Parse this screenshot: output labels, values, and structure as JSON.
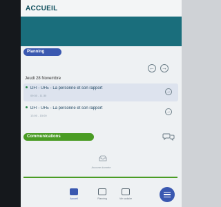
{
  "header": {
    "title": "ACCUEIL"
  },
  "hero": {
    "greeting": ""
  },
  "planning": {
    "label": "Planning",
    "date": "Jeudi 28 Novembre",
    "prev_icon": "arrow-left-icon",
    "next_icon": "arrow-right-icon",
    "courses": [
      {
        "title": "DFI - UFE - La personne et son rapport",
        "time": "09:30 - 11:30"
      },
      {
        "title": "DFI - UFE - La personne et son rapport",
        "time": "13:00 - 15:00"
      }
    ]
  },
  "communications": {
    "label": "Communications",
    "icon": "chat-bubbles-icon",
    "empty_icon": "inbox-icon",
    "empty_text": "Aucune donnée"
  },
  "bottom_nav": {
    "items": [
      {
        "label": "Accueil",
        "icon": "home-icon"
      },
      {
        "label": "Planning",
        "icon": "calendar-icon"
      },
      {
        "label": "Vie scolaire",
        "icon": "school-icon"
      }
    ],
    "fab_icon": "menu-icon"
  },
  "colors": {
    "accent": "#3a58b0",
    "hero": "#1a6e7c",
    "green": "#4a9c24"
  }
}
